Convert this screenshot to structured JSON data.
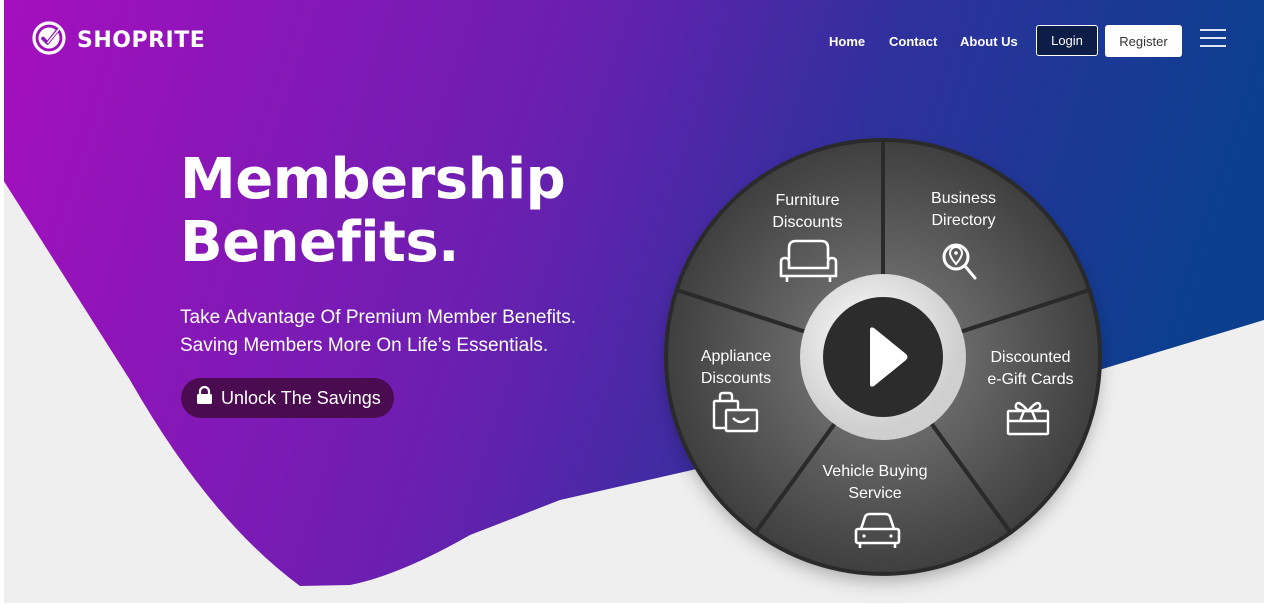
{
  "brand": {
    "name": "SHOPRITE",
    "logo_icon": "check-circle-icon"
  },
  "nav": {
    "links": [
      "Home",
      "Contact",
      "About Us"
    ],
    "login_label": "Login",
    "register_label": "Register",
    "menu_icon": "hamburger-menu-icon"
  },
  "hero": {
    "title_line1": "Membership",
    "title_line2": "Benefits.",
    "subtitle_line1": "Take Advantage Of Premium Member Benefits.",
    "subtitle_line2": "Saving Members More On Life’s Essentials.",
    "cta_label": "Unlock The Savings",
    "cta_icon": "lock-icon"
  },
  "wheel": {
    "segments": [
      {
        "line1": "Furniture",
        "line2": "Discounts",
        "icon": "sofa-icon"
      },
      {
        "line1": "Business",
        "line2": "Directory",
        "icon": "search-location-icon"
      },
      {
        "line1": "Discounted",
        "line2": "e-Gift Cards",
        "icon": "gift-icon"
      },
      {
        "line1": "Vehicle Buying",
        "line2": "Service",
        "icon": "car-icon"
      },
      {
        "line1": "Appliance",
        "line2": "Discounts",
        "icon": "appliance-bag-icon"
      }
    ],
    "center_icon": "play-icon"
  },
  "colors": {
    "gradient_start": "#a50fbe",
    "gradient_mid": "#5a23a6",
    "gradient_end": "#0b3f8e",
    "cta_bg": "#4a0b50",
    "login_bg": "#0c1d47",
    "page_bg": "#efefef"
  }
}
